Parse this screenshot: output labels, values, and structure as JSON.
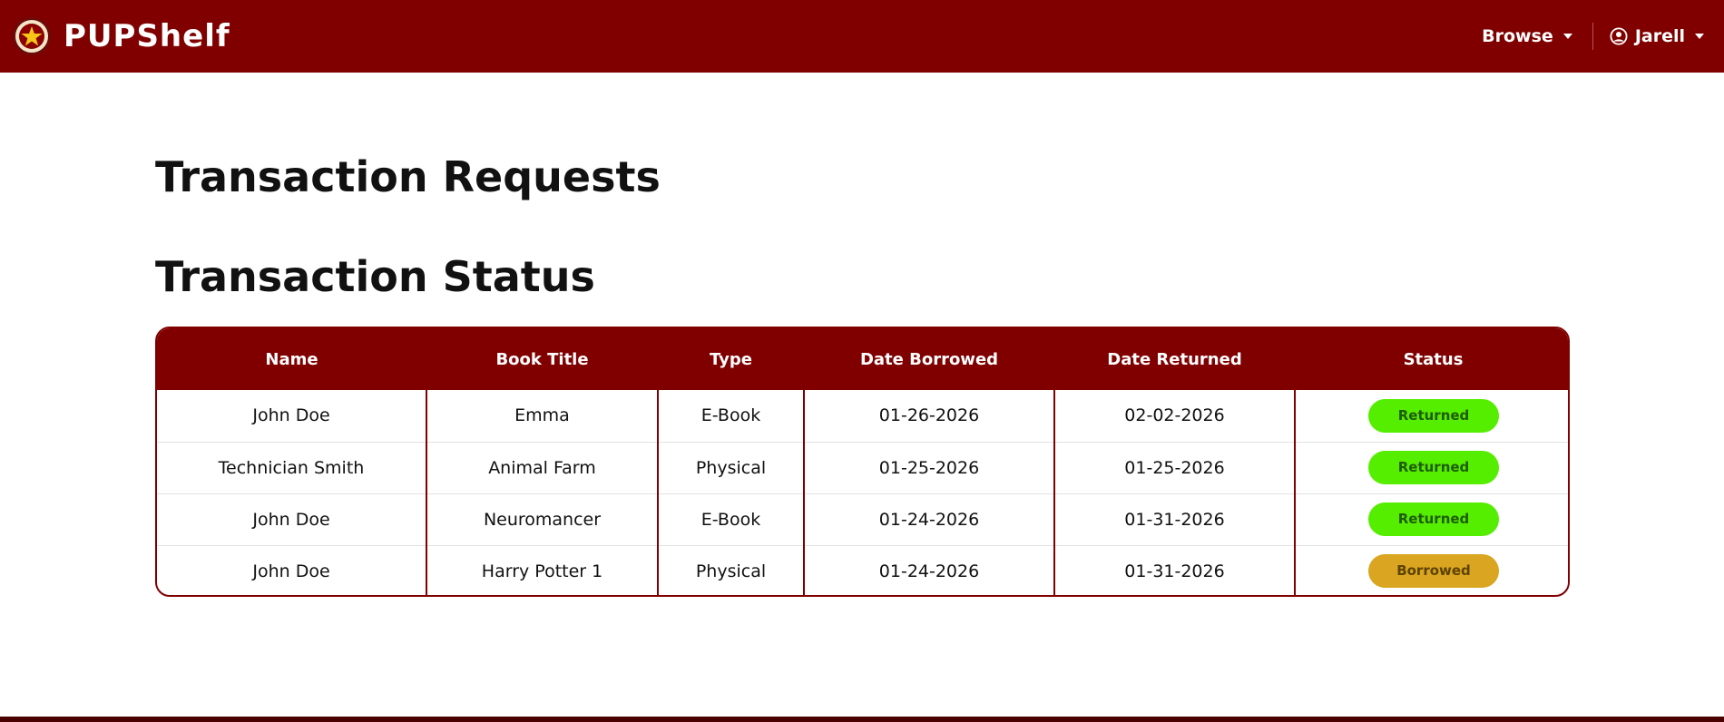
{
  "navbar": {
    "brand": "PUPShelf",
    "browse_label": "Browse",
    "user_label": "Jarell"
  },
  "headings": {
    "requests": "Transaction Requests",
    "status": "Transaction Status"
  },
  "table": {
    "columns": [
      "Name",
      "Book Title",
      "Type",
      "Date Borrowed",
      "Date Returned",
      "Status"
    ],
    "rows": [
      {
        "name": "John Doe",
        "title": "Emma",
        "type": "E-Book",
        "borrowed": "01-26-2026",
        "returned": "02-02-2026",
        "status": "Returned"
      },
      {
        "name": "Technician Smith",
        "title": "Animal Farm",
        "type": "Physical",
        "borrowed": "01-25-2026",
        "returned": "01-25-2026",
        "status": "Returned"
      },
      {
        "name": "John Doe",
        "title": "Neuromancer",
        "type": "E-Book",
        "borrowed": "01-24-2026",
        "returned": "01-31-2026",
        "status": "Returned"
      },
      {
        "name": "John Doe",
        "title": "Harry Potter 1",
        "type": "Physical",
        "borrowed": "01-24-2026",
        "returned": "01-31-2026",
        "status": "Borrowed"
      }
    ]
  },
  "colors": {
    "brand": "#800000",
    "returned_badge": "#55ee00",
    "returned_text": "#1f5c00",
    "borrowed_badge": "#daa520",
    "borrowed_text": "#5c4300"
  },
  "icons": {
    "logo": "pup-seal-logo",
    "browse": "chevron-down-icon",
    "user": "user-circle-icon"
  }
}
